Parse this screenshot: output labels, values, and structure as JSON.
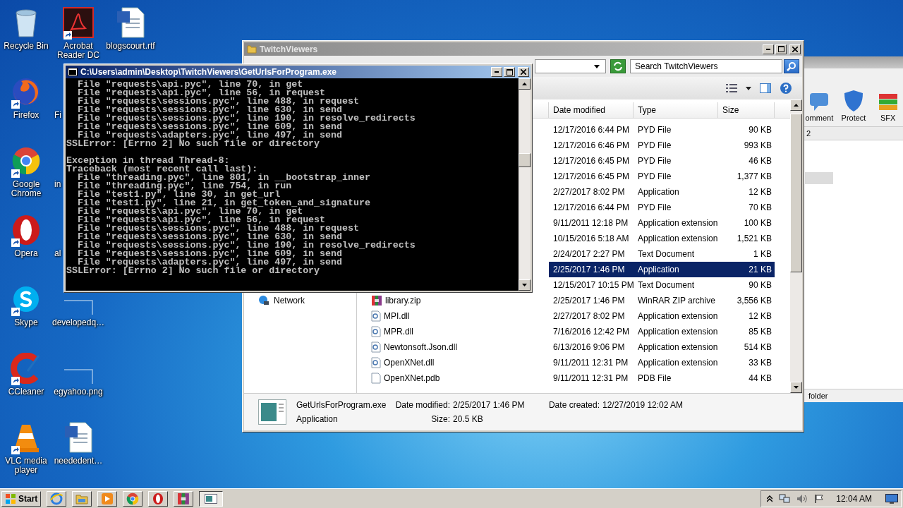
{
  "desktop": {
    "icons": [
      {
        "label": "Recycle Bin",
        "kind": "recycle",
        "shortcut": false
      },
      {
        "label": "Firefox",
        "kind": "firefox",
        "shortcut": true
      },
      {
        "label": "Google Chrome",
        "kind": "chrome",
        "shortcut": true
      },
      {
        "label": "Opera",
        "kind": "opera",
        "shortcut": true
      },
      {
        "label": "Skype",
        "kind": "skype",
        "shortcut": true
      },
      {
        "label": "CCleaner",
        "kind": "ccleaner",
        "shortcut": true
      },
      {
        "label": "VLC media player",
        "kind": "vlc",
        "shortcut": true
      },
      {
        "label": "Acrobat Reader DC",
        "kind": "acrobat",
        "shortcut": true
      },
      {
        "label": "Fi",
        "kind": "hidden",
        "shortcut": false
      },
      {
        "label": "in",
        "kind": "hidden",
        "shortcut": false
      },
      {
        "label": "al",
        "kind": "hidden",
        "shortcut": false
      },
      {
        "label": "developedq…",
        "kind": "faint",
        "shortcut": false
      },
      {
        "label": "egyahoo.png",
        "kind": "faint",
        "shortcut": false
      },
      {
        "label": "neededent…",
        "kind": "word",
        "shortcut": false
      },
      {
        "label": "blogscourt.rtf",
        "kind": "word",
        "shortcut": false
      }
    ]
  },
  "back_window": {
    "tools": [
      {
        "label": "omment",
        "kind": "comment"
      },
      {
        "label": "Protect",
        "kind": "shield"
      },
      {
        "label": "SFX",
        "kind": "sfx"
      }
    ],
    "column": "2",
    "status": "folder"
  },
  "explorer": {
    "title": "TwitchViewers",
    "search": {
      "placeholder": "Search TwitchViewers"
    },
    "columns": [
      "Date modified",
      "Type",
      "Size"
    ],
    "rows": [
      {
        "date": "12/17/2016 6:44 PM",
        "type": "PYD File",
        "size": "90 KB",
        "selected": false
      },
      {
        "date": "12/17/2016 6:46 PM",
        "type": "PYD File",
        "size": "993 KB",
        "selected": false
      },
      {
        "date": "12/17/2016 6:45 PM",
        "type": "PYD File",
        "size": "46 KB",
        "selected": false
      },
      {
        "date": "12/17/2016 6:45 PM",
        "type": "PYD File",
        "size": "1,377 KB",
        "selected": false
      },
      {
        "date": "2/27/2017 8:02 PM",
        "type": "Application",
        "size": "12 KB",
        "selected": false
      },
      {
        "date": "12/17/2016 6:44 PM",
        "type": "PYD File",
        "size": "70 KB",
        "selected": false
      },
      {
        "date": "9/11/2011 12:18 PM",
        "type": "Application extension",
        "size": "100 KB",
        "selected": false
      },
      {
        "date": "10/15/2016 5:18 AM",
        "type": "Application extension",
        "size": "1,521 KB",
        "selected": false
      },
      {
        "date": "2/24/2017 2:27 PM",
        "type": "Text Document",
        "size": "1 KB",
        "selected": false
      },
      {
        "date": "2/25/2017 1:46 PM",
        "type": "Application",
        "size": "21 KB",
        "selected": true
      },
      {
        "date": "12/15/2017 10:15 PM",
        "type": "Text Document",
        "size": "90 KB",
        "selected": false
      },
      {
        "name": "library.zip",
        "kind": "zip",
        "date": "2/25/2017 1:46 PM",
        "type": "WinRAR ZIP archive",
        "size": "3,556 KB",
        "selected": false
      },
      {
        "name": "MPI.dll",
        "kind": "dll",
        "date": "2/27/2017 8:02 PM",
        "type": "Application extension",
        "size": "12 KB",
        "selected": false
      },
      {
        "name": "MPR.dll",
        "kind": "dll",
        "date": "7/16/2016 12:42 PM",
        "type": "Application extension",
        "size": "85 KB",
        "selected": false
      },
      {
        "name": "Newtonsoft.Json.dll",
        "kind": "dll",
        "date": "6/13/2016 9:06 PM",
        "type": "Application extension",
        "size": "514 KB",
        "selected": false
      },
      {
        "name": "OpenXNet.dll",
        "kind": "dll",
        "date": "9/11/2011 12:31 PM",
        "type": "Application extension",
        "size": "33 KB",
        "selected": false
      },
      {
        "name": "OpenXNet.pdb",
        "kind": "file",
        "date": "9/11/2011 12:31 PM",
        "type": "PDB File",
        "size": "44 KB",
        "selected": false
      }
    ],
    "nav": [
      {
        "label": "Network"
      }
    ],
    "details": {
      "name": "GetUrlsForProgram.exe",
      "type": "Application",
      "modified": {
        "label": "Date modified:",
        "value": "2/25/2017 1:46 PM"
      },
      "size": {
        "label": "Size:",
        "value": "20.5 KB"
      },
      "created": {
        "label": "Date created:",
        "value": "12/27/2019 12:02 AM"
      }
    }
  },
  "console": {
    "title": "C:\\Users\\admin\\Desktop\\TwitchViewers\\GetUrlsForProgram.exe",
    "blocks": [
      [
        "  File \"requests\\api.pyc\", line 70, in get",
        "  File \"requests\\api.pyc\", line 56, in request",
        "  File \"requests\\sessions.pyc\", line 488, in request",
        "  File \"requests\\sessions.pyc\", line 630, in send",
        "  File \"requests\\sessions.pyc\", line 190, in resolve_redirects",
        "  File \"requests\\sessions.pyc\", line 609, in send",
        "  File \"requests\\adapters.pyc\", line 497, in send",
        "SSLError: [Errno 2] No such file or directory"
      ],
      [
        "Exception in thread Thread-8:",
        "Traceback (most recent call last):",
        "  File \"threading.pyc\", line 801, in __bootstrap_inner",
        "  File \"threading.pyc\", line 754, in run",
        "  File \"test1.py\", line 30, in get_url",
        "  File \"test1.py\", line 21, in get_token_and_signature",
        "  File \"requests\\api.pyc\", line 70, in get",
        "  File \"requests\\api.pyc\", line 56, in request",
        "  File \"requests\\sessions.pyc\", line 488, in request",
        "  File \"requests\\sessions.pyc\", line 630, in send",
        "  File \"requests\\sessions.pyc\", line 190, in resolve_redirects",
        "  File \"requests\\sessions.pyc\", line 609, in send",
        "  File \"requests\\adapters.pyc\", line 497, in send",
        "SSLError: [Errno 2] No such file or directory"
      ]
    ]
  },
  "taskbar": {
    "start": "Start",
    "apps": [
      {
        "kind": "ie",
        "selected": false
      },
      {
        "kind": "folder",
        "selected": false
      },
      {
        "kind": "media",
        "selected": false
      },
      {
        "kind": "chrome",
        "selected": false
      },
      {
        "kind": "opera",
        "selected": false
      },
      {
        "kind": "winrar",
        "selected": false
      },
      {
        "kind": "window",
        "selected": true
      }
    ],
    "time": "12:04 AM"
  }
}
